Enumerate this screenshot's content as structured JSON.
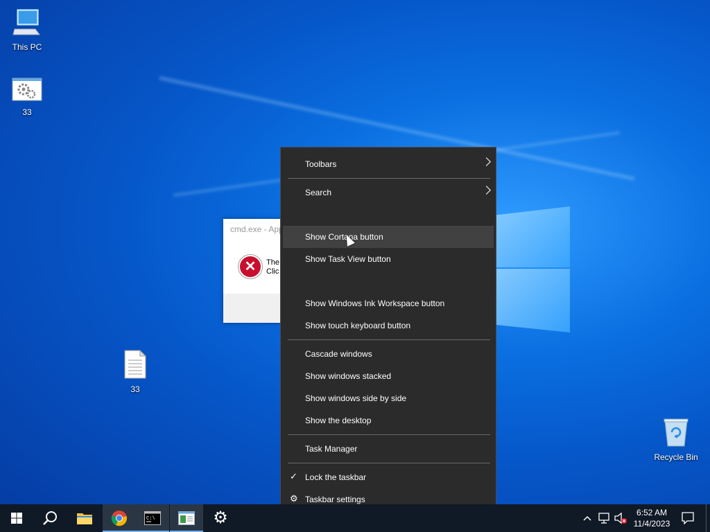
{
  "desktop": {
    "icons": [
      {
        "label": "This PC",
        "icon": "this-pc-icon"
      },
      {
        "label": "33",
        "icon": "settings-shortcut-icon"
      },
      {
        "label": "33",
        "icon": "text-file-icon"
      },
      {
        "label": "Recycle Bin",
        "icon": "recycle-bin-icon"
      }
    ]
  },
  "dialog": {
    "title": "cmd.exe - App",
    "message_line1": "The",
    "message_line2": "Clic"
  },
  "context_menu": {
    "items": [
      {
        "label": "Toolbars",
        "submenu": true
      },
      {
        "label": "Search",
        "submenu": true
      },
      {
        "label": "Show Cortana button",
        "hovered": true
      },
      {
        "label": "Show Task View button"
      },
      {
        "label": "Show Windows Ink Workspace button"
      },
      {
        "label": "Show touch keyboard button"
      },
      {
        "label": "Cascade windows"
      },
      {
        "label": "Show windows stacked"
      },
      {
        "label": "Show windows side by side"
      },
      {
        "label": "Show the desktop"
      },
      {
        "label": "Task Manager"
      },
      {
        "label": "Lock the taskbar",
        "checked": true
      },
      {
        "label": "Taskbar settings",
        "icon": "gear-icon"
      }
    ]
  },
  "taskbar": {
    "buttons": [
      {
        "name": "start",
        "icon": "windows-logo-icon"
      },
      {
        "name": "search",
        "icon": "search-icon"
      },
      {
        "name": "file-explorer",
        "icon": "folder-icon"
      },
      {
        "name": "chrome",
        "icon": "chrome-icon"
      },
      {
        "name": "command-prompt",
        "icon": "terminal-icon"
      },
      {
        "name": "active-app",
        "icon": "window-app-icon"
      },
      {
        "name": "settings",
        "icon": "gear-icon"
      }
    ],
    "clock": {
      "time": "6:52 AM",
      "date": "11/4/2023"
    }
  },
  "colors": {
    "menu_bg": "#2b2b2b",
    "menu_hover": "#414141",
    "taskbar_bg": "#101a26",
    "error_red": "#c8102e"
  }
}
